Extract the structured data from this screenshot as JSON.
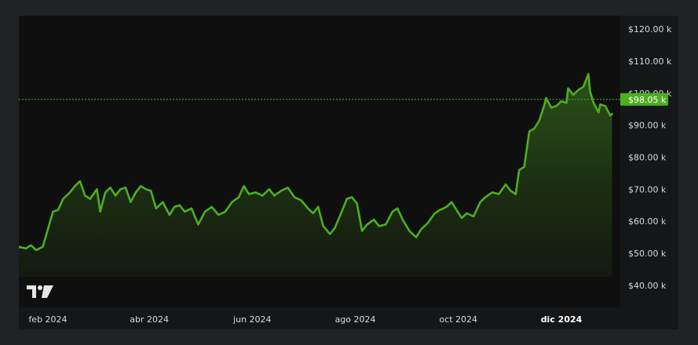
{
  "chart_data": {
    "type": "area",
    "title": "",
    "xlabel": "",
    "ylabel": "",
    "ylim": [
      40000,
      125000
    ],
    "xlim": [
      "2024-01-01",
      "2024-12-31"
    ],
    "grid": false,
    "y_ticks": [
      "$40.00 k",
      "$50.00 k",
      "$60.00 k",
      "$70.00 k",
      "$80.00 k",
      "$90.00 k",
      "$100.00 k",
      "$110.00 k",
      "$120.00 k"
    ],
    "y_tick_values": [
      40000,
      50000,
      60000,
      70000,
      80000,
      90000,
      100000,
      110000,
      120000
    ],
    "x_ticks": [
      {
        "label": "feb 2024",
        "date": "2024-02-01",
        "bold": false
      },
      {
        "label": "abr 2024",
        "date": "2024-04-01",
        "bold": false
      },
      {
        "label": "jun 2024",
        "date": "2024-06-01",
        "bold": false
      },
      {
        "label": "ago 2024",
        "date": "2024-08-01",
        "bold": false
      },
      {
        "label": "oct 2024",
        "date": "2024-10-01",
        "bold": false
      },
      {
        "label": "dic 2024",
        "date": "2024-12-01",
        "bold": true
      }
    ],
    "current_price": {
      "value": 98050,
      "label": "$98.05 k"
    },
    "series": [
      {
        "color": "#4caf1f",
        "points": [
          [
            "2024-01-01",
            42500
          ],
          [
            "2024-01-05",
            45000
          ],
          [
            "2024-01-09",
            48000
          ],
          [
            "2024-01-12",
            50000
          ],
          [
            "2024-01-15",
            52000
          ],
          [
            "2024-01-19",
            51500
          ],
          [
            "2024-01-22",
            52500
          ],
          [
            "2024-01-25",
            51000
          ],
          [
            "2024-01-29",
            52000
          ],
          [
            "2024-02-01",
            57500
          ],
          [
            "2024-02-04",
            63000
          ],
          [
            "2024-02-07",
            63500
          ],
          [
            "2024-02-10",
            67000
          ],
          [
            "2024-02-14",
            69000
          ],
          [
            "2024-02-17",
            71000
          ],
          [
            "2024-02-20",
            72500
          ],
          [
            "2024-02-23",
            68000
          ],
          [
            "2024-02-26",
            67000
          ],
          [
            "2024-03-01",
            70000
          ],
          [
            "2024-03-03",
            63000
          ],
          [
            "2024-03-06",
            69000
          ],
          [
            "2024-03-09",
            70500
          ],
          [
            "2024-03-12",
            68000
          ],
          [
            "2024-03-15",
            70000
          ],
          [
            "2024-03-18",
            70500
          ],
          [
            "2024-03-21",
            66000
          ],
          [
            "2024-03-24",
            69000
          ],
          [
            "2024-03-27",
            71000
          ],
          [
            "2024-03-30",
            70000
          ],
          [
            "2024-04-02",
            69500
          ],
          [
            "2024-04-05",
            64000
          ],
          [
            "2024-04-09",
            66000
          ],
          [
            "2024-04-13",
            62000
          ],
          [
            "2024-04-16",
            64500
          ],
          [
            "2024-04-19",
            65000
          ],
          [
            "2024-04-22",
            63000
          ],
          [
            "2024-04-26",
            64000
          ],
          [
            "2024-04-30",
            59000
          ],
          [
            "2024-05-04",
            63000
          ],
          [
            "2024-05-08",
            64500
          ],
          [
            "2024-05-12",
            62000
          ],
          [
            "2024-05-16",
            63000
          ],
          [
            "2024-05-20",
            66000
          ],
          [
            "2024-05-24",
            67500
          ],
          [
            "2024-05-27",
            71000
          ],
          [
            "2024-05-30",
            68500
          ],
          [
            "2024-06-03",
            69000
          ],
          [
            "2024-06-07",
            68000
          ],
          [
            "2024-06-11",
            70000
          ],
          [
            "2024-06-14",
            68000
          ],
          [
            "2024-06-18",
            69500
          ],
          [
            "2024-06-22",
            70500
          ],
          [
            "2024-06-26",
            67500
          ],
          [
            "2024-06-30",
            66500
          ],
          [
            "2024-07-04",
            64000
          ],
          [
            "2024-07-07",
            62500
          ],
          [
            "2024-07-10",
            64500
          ],
          [
            "2024-07-13",
            58500
          ],
          [
            "2024-07-17",
            56000
          ],
          [
            "2024-07-20",
            58000
          ],
          [
            "2024-07-24",
            63000
          ],
          [
            "2024-07-27",
            67000
          ],
          [
            "2024-07-30",
            67500
          ],
          [
            "2024-08-02",
            65500
          ],
          [
            "2024-08-05",
            57000
          ],
          [
            "2024-08-08",
            59000
          ],
          [
            "2024-08-12",
            60500
          ],
          [
            "2024-08-15",
            58500
          ],
          [
            "2024-08-19",
            59000
          ],
          [
            "2024-08-23",
            63000
          ],
          [
            "2024-08-26",
            64000
          ],
          [
            "2024-08-29",
            60500
          ],
          [
            "2024-09-02",
            57000
          ],
          [
            "2024-09-06",
            55000
          ],
          [
            "2024-09-09",
            57500
          ],
          [
            "2024-09-13",
            59500
          ],
          [
            "2024-09-17",
            62500
          ],
          [
            "2024-09-20",
            63500
          ],
          [
            "2024-09-24",
            64500
          ],
          [
            "2024-09-27",
            66000
          ],
          [
            "2024-09-30",
            63500
          ],
          [
            "2024-10-03",
            61000
          ],
          [
            "2024-10-06",
            62500
          ],
          [
            "2024-10-10",
            61500
          ],
          [
            "2024-10-14",
            66000
          ],
          [
            "2024-10-17",
            67500
          ],
          [
            "2024-10-21",
            69000
          ],
          [
            "2024-10-25",
            68500
          ],
          [
            "2024-10-29",
            71500
          ],
          [
            "2024-11-01",
            69500
          ],
          [
            "2024-11-04",
            68500
          ],
          [
            "2024-11-06",
            76000
          ],
          [
            "2024-11-09",
            77000
          ],
          [
            "2024-11-12",
            88000
          ],
          [
            "2024-11-15",
            89000
          ],
          [
            "2024-11-18",
            91500
          ],
          [
            "2024-11-21",
            96500
          ],
          [
            "2024-11-22",
            98500
          ],
          [
            "2024-11-25",
            95500
          ],
          [
            "2024-11-28",
            96000
          ],
          [
            "2024-12-01",
            97500
          ],
          [
            "2024-12-04",
            97000
          ],
          [
            "2024-12-05",
            101500
          ],
          [
            "2024-12-08",
            99500
          ],
          [
            "2024-12-11",
            101000
          ],
          [
            "2024-12-14",
            102000
          ],
          [
            "2024-12-17",
            106000
          ],
          [
            "2024-12-18",
            100500
          ],
          [
            "2024-12-20",
            97000
          ],
          [
            "2024-12-23",
            94000
          ],
          [
            "2024-12-24",
            96500
          ],
          [
            "2024-12-27",
            96000
          ],
          [
            "2024-12-30",
            93000
          ],
          [
            "2024-12-31",
            93500
          ]
        ]
      }
    ]
  }
}
